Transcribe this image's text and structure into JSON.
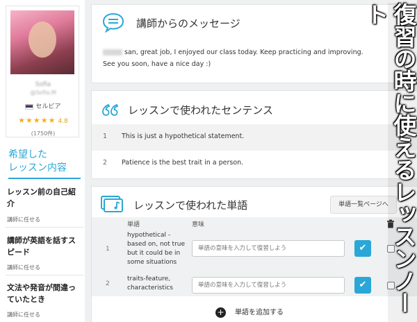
{
  "teacher": {
    "name": "Sofia",
    "handle": "@Sofia.M",
    "country": "セルビア",
    "rating_stars": 4.8,
    "rating_value": "4.8",
    "review_count": "(1750件)"
  },
  "wish": {
    "heading": "希望した\nレッスン内容",
    "items": [
      {
        "title": "レッスン前の自己紹介",
        "sub": "講師に任せる"
      },
      {
        "title": "講師が英語を話すスピード",
        "sub": "講師に任せる"
      },
      {
        "title": "文法や発音が間違っていたとき",
        "sub": "講師に任せる"
      }
    ]
  },
  "message": {
    "title": "講師からのメッセージ",
    "body": "san, great job, I enjoyed our class today. Keep practicing and improving. See you soon, have a nice day :)"
  },
  "sentences": {
    "title": "レッスンで使われたセンテンス",
    "rows": [
      {
        "num": "1",
        "text": "This is just a hypothetical statement."
      },
      {
        "num": "2",
        "text": "Patience is the best trait in a person."
      }
    ]
  },
  "words": {
    "title": "レッスンで使われた単語",
    "list_button": "単語一覧ページへ",
    "headers": {
      "word": "単語",
      "meaning": "意味"
    },
    "input_placeholder": "単語の意味を入力して復習しよう",
    "rows": [
      {
        "num": "1",
        "word": "hypothetical -based on, not true but it could be in some situations"
      },
      {
        "num": "2",
        "word": "traits-feature, characteristics"
      }
    ],
    "add_label": "単語を追加する"
  },
  "banner": "復習の時に使えるレッスンノート",
  "icons": {
    "message": "chat-bubble-icon",
    "quote": "quote-icon",
    "vocab": "book-card-icon",
    "delete": "trash-icon",
    "check": "checkmark-icon",
    "add": "plus-circle-icon",
    "flag": "serbia-flag-icon"
  },
  "colors": {
    "accent": "#2aa7d6",
    "star": "#f2b01e"
  }
}
